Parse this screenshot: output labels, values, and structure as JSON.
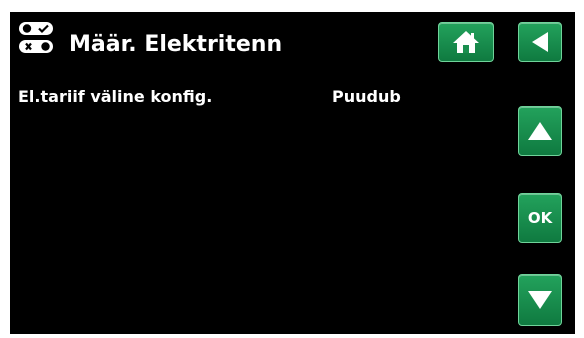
{
  "header": {
    "title": "Määr. Elektritenn",
    "title_icon": "toggle-switches-icon",
    "home_icon": "home-icon",
    "back_icon": "back-arrow-icon"
  },
  "settings": [
    {
      "label": "El.tariif väline konfig.",
      "value": "Puudub"
    }
  ],
  "nav": {
    "up_icon": "up-arrow-icon",
    "ok_label": "OK",
    "down_icon": "down-arrow-icon"
  },
  "colors": {
    "background": "#000000",
    "text": "#ffffff",
    "button_green": "#1a8f4f"
  }
}
